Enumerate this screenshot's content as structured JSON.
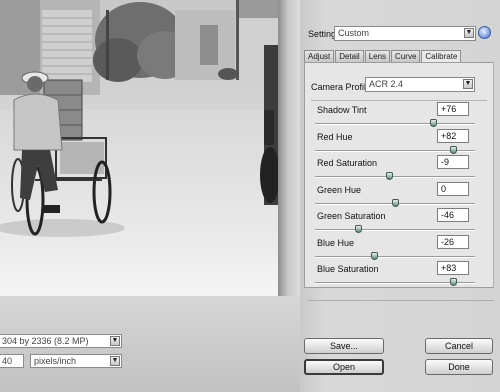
{
  "settings": {
    "label": "Settings:",
    "value": "Custom",
    "menu_icon": "circle-arrow-icon"
  },
  "tabs": [
    {
      "label": "Adjust"
    },
    {
      "label": "Detail"
    },
    {
      "label": "Lens"
    },
    {
      "label": "Curve"
    },
    {
      "label": "Calibrate",
      "active": true
    }
  ],
  "calibrate": {
    "profile_label": "Camera Profile:",
    "profile_value": "ACR 2.4",
    "sliders": [
      {
        "label": "Shadow Tint",
        "value": "+76",
        "level": 0.74
      },
      {
        "label": "Red Hue",
        "value": "+82",
        "level": 0.86
      },
      {
        "label": "Red Saturation",
        "value": "-9",
        "level": 0.46
      },
      {
        "label": "Green Hue",
        "value": "0",
        "level": 0.5
      },
      {
        "label": "Green Saturation",
        "value": "-46",
        "level": 0.27
      },
      {
        "label": "Blue Hue",
        "value": "-26",
        "level": 0.37
      },
      {
        "label": "Blue Saturation",
        "value": "+83",
        "level": 0.86
      }
    ]
  },
  "workflow": {
    "size_value": "304 by 2336  (8.2 MP)",
    "resolution_value": "40",
    "resolution_unit": "pixels/inch"
  },
  "buttons": {
    "save": "Save...",
    "open": "Open",
    "cancel": "Cancel",
    "done": "Done"
  },
  "colors": {
    "slider_thumb": "#5e8a7a",
    "menu_button": "#4a75c8"
  }
}
